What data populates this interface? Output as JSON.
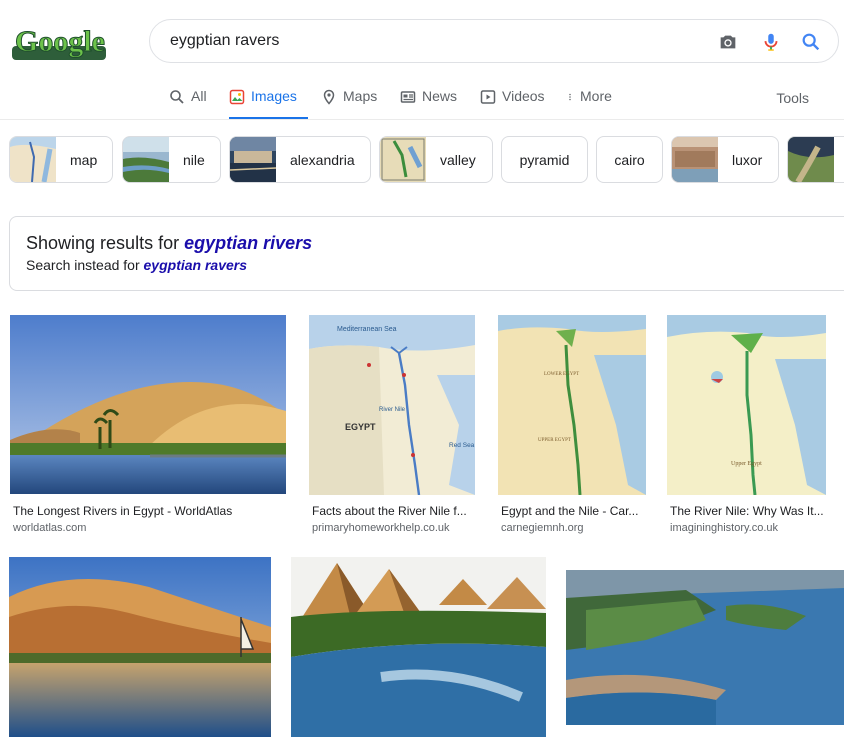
{
  "header": {
    "logo_text": "Google",
    "query": "eygptian ravers"
  },
  "tabs": [
    {
      "label": "All"
    },
    {
      "label": "Images"
    },
    {
      "label": "Maps"
    },
    {
      "label": "News"
    },
    {
      "label": "Videos"
    },
    {
      "label": "More"
    }
  ],
  "tools_label": "Tools",
  "chips": [
    {
      "label": "map"
    },
    {
      "label": "nile"
    },
    {
      "label": "alexandria"
    },
    {
      "label": "valley"
    },
    {
      "label": "pyramid"
    },
    {
      "label": "cairo"
    },
    {
      "label": "luxor"
    }
  ],
  "spelling": {
    "showing_prefix": "Showing results for ",
    "corrected": "egyptian rivers",
    "instead_prefix": "Search instead for ",
    "original": "eygptian ravers"
  },
  "results": [
    {
      "title": "The Longest Rivers in Egypt - WorldAtlas",
      "source": "worldatlas.com"
    },
    {
      "title": "Facts about the River Nile f...",
      "source": "primaryhomeworkhelp.co.uk"
    },
    {
      "title": "Egypt and the Nile - Car...",
      "source": "carnegiemnh.org"
    },
    {
      "title": "The River Nile: Why Was It...",
      "source": "imagininghistory.co.uk"
    }
  ],
  "map_labels": {
    "sea": "Mediterranean Sea",
    "country": "EGYPT",
    "river": "River Nile",
    "red_sea": "Red Sea",
    "lower_egypt": "LOWER EGYPT",
    "upper_egypt": "UPPER EGYPT",
    "upper_egypt_2": "Upper Egypt"
  }
}
